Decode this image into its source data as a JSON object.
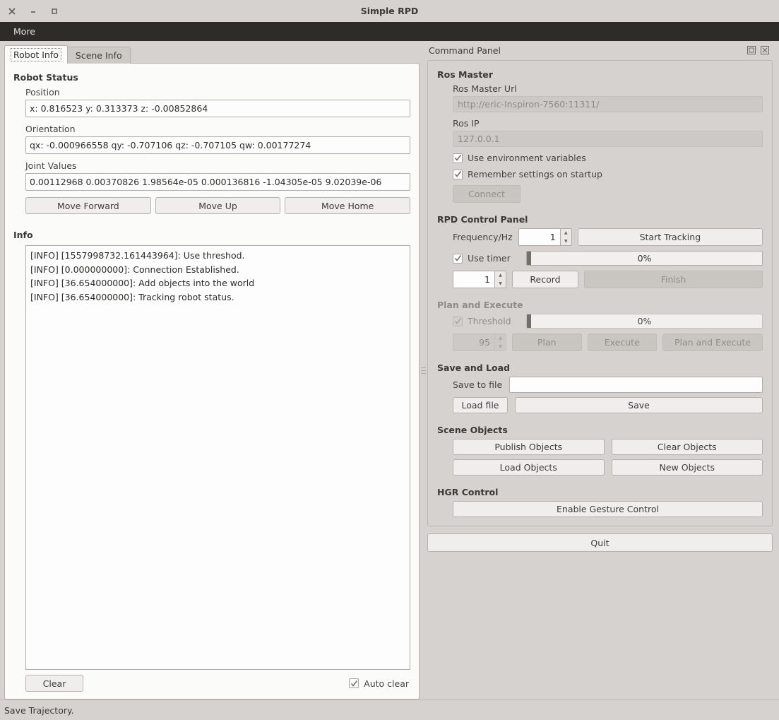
{
  "window": {
    "title": "Simple RPD",
    "controls": [
      {
        "name": "close",
        "glyph": "✕"
      },
      {
        "name": "minimize",
        "glyph": "–"
      },
      {
        "name": "maximize",
        "glyph": "□"
      }
    ]
  },
  "menubar": {
    "items": [
      "More"
    ]
  },
  "tabs": [
    {
      "label": "Robot Info",
      "active": true
    },
    {
      "label": "Scene Info",
      "active": false
    }
  ],
  "robot_status": {
    "title": "Robot Status",
    "fields": [
      {
        "label": "Position",
        "value": "x: 0.816523 y: 0.313373 z: -0.00852864"
      },
      {
        "label": "Orientation",
        "value": "qx: -0.000966558 qy: -0.707106 qz: -0.707105 qw: 0.00177274"
      },
      {
        "label": "Joint Values",
        "value": "0.00112968 0.00370826 1.98564e-05 0.000136816 -1.04305e-05 9.02039e-06"
      }
    ],
    "buttons": [
      "Move Forward",
      "Move Up",
      "Move Home"
    ]
  },
  "info": {
    "title": "Info",
    "lines": [
      "[INFO] [1557998732.161443964]: Use threshod.",
      "[INFO] [0.000000000]: Connection Established.",
      "[INFO] [36.654000000]: Add objects into the world",
      "[INFO] [36.654000000]: Tracking robot status."
    ],
    "clear_button": "Clear",
    "auto_clear_label": "Auto clear",
    "auto_clear_checked": true
  },
  "command_panel": {
    "title": "Command Panel",
    "ros_master": {
      "title": "Ros Master",
      "url_label": "Ros Master Url",
      "url_placeholder": "http://eric-Inspiron-7560:11311/",
      "ip_label": "Ros IP",
      "ip_placeholder": "127.0.0.1",
      "use_env_label": "Use environment variables",
      "use_env_checked": true,
      "remember_label": "Remember settings on startup",
      "remember_checked": true,
      "connect_label": "Connect",
      "connect_enabled": false
    },
    "rpd_control": {
      "title": "RPD Control Panel",
      "frequency_label": "Frequency/Hz",
      "frequency_value": "1",
      "start_tracking_label": "Start Tracking",
      "use_timer_label": "Use timer",
      "use_timer_checked": true,
      "timer_progress_text": "0%",
      "timer_progress_value": 0,
      "count_value": "1",
      "record_label": "Record",
      "finish_label": "Finish",
      "finish_enabled": false
    },
    "plan_execute": {
      "title": "Plan and Execute",
      "enabled": false,
      "threshold_label": "Threshold",
      "threshold_checked": true,
      "threshold_progress_text": "0%",
      "threshold_progress_value": 0,
      "threshold_value": "95",
      "plan_label": "Plan",
      "execute_label": "Execute",
      "plan_and_execute_label": "Plan and Execute"
    },
    "save_load": {
      "title": "Save and Load",
      "save_to_file_label": "Save to file",
      "save_to_file_value": "",
      "load_file_label": "Load file",
      "save_label": "Save"
    },
    "scene_objects": {
      "title": "Scene Objects",
      "buttons": [
        "Publish Objects",
        "Clear Objects",
        "Load Objects",
        "New Objects"
      ]
    },
    "hgr_control": {
      "title": "HGR Control",
      "enable_label": "Enable Gesture Control"
    },
    "quit_label": "Quit"
  },
  "statusbar": {
    "text": "Save Trajectory."
  }
}
